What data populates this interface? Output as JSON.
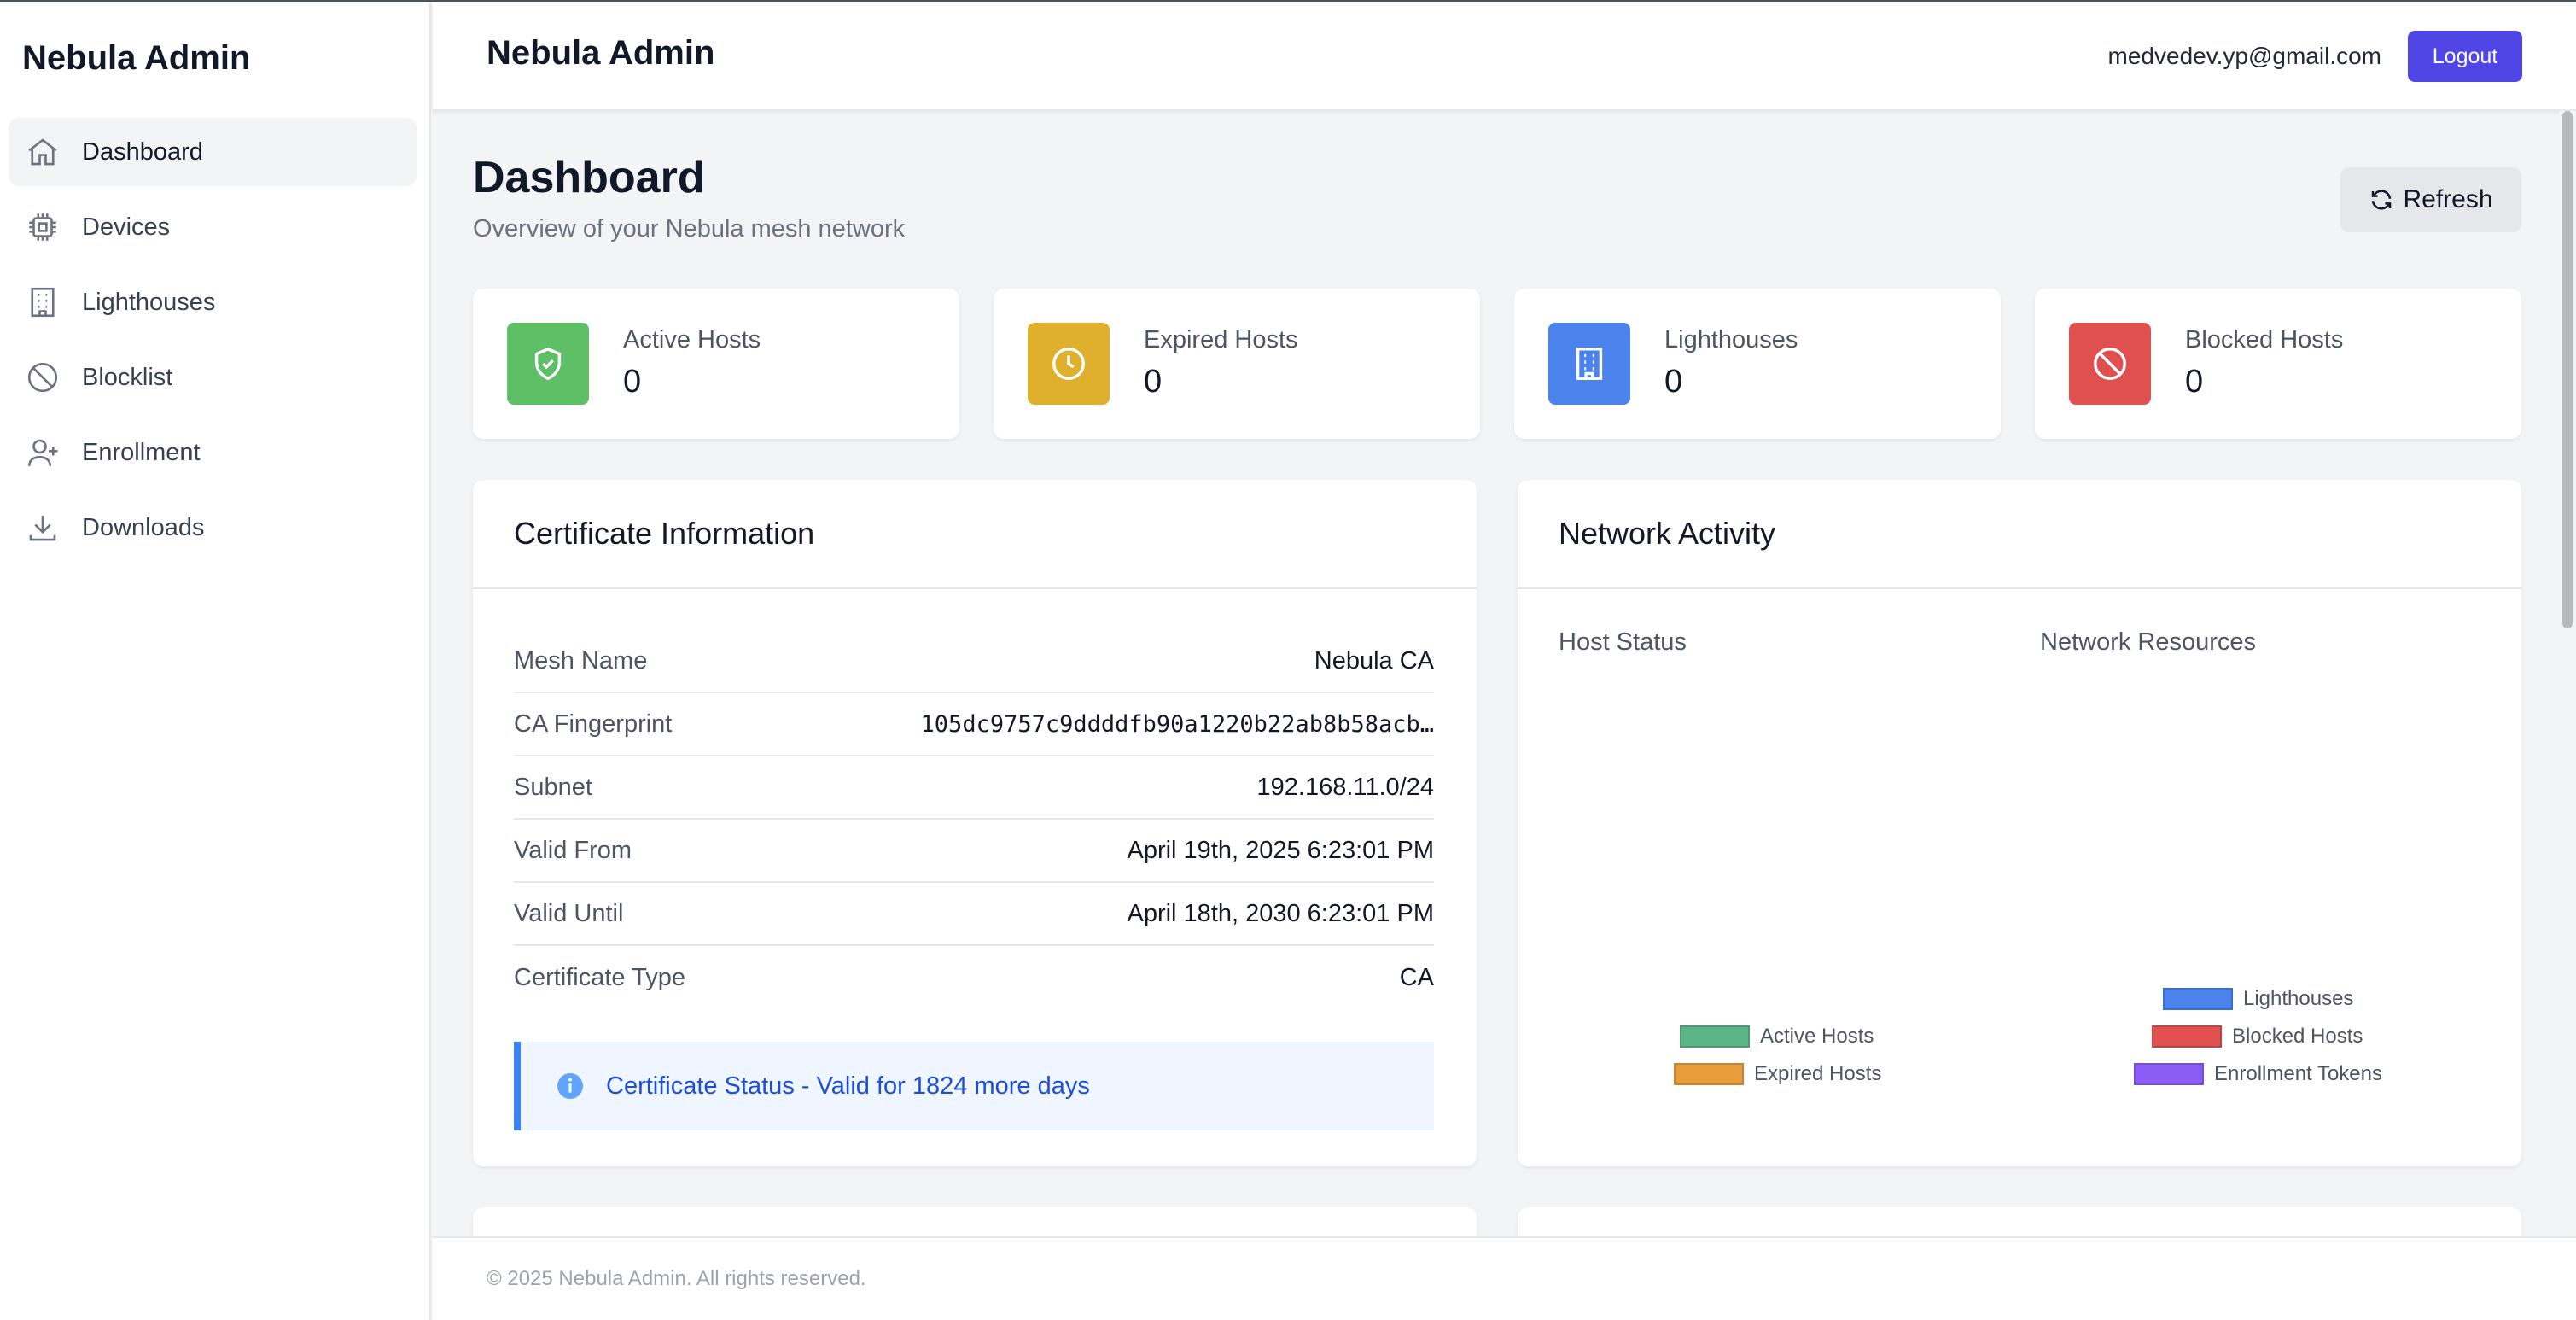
{
  "sidebar": {
    "brand": "Nebula Admin",
    "items": [
      {
        "label": "Dashboard",
        "icon": "home-icon",
        "active": true
      },
      {
        "label": "Devices",
        "icon": "chip-icon",
        "active": false
      },
      {
        "label": "Lighthouses",
        "icon": "building-icon",
        "active": false
      },
      {
        "label": "Blocklist",
        "icon": "ban-icon",
        "active": false
      },
      {
        "label": "Enrollment",
        "icon": "user-plus-icon",
        "active": false
      },
      {
        "label": "Downloads",
        "icon": "download-icon",
        "active": false
      }
    ]
  },
  "header": {
    "title": "Nebula Admin",
    "email": "medvedev.yp@gmail.com",
    "logout_label": "Logout"
  },
  "page": {
    "title": "Dashboard",
    "subtitle": "Overview of your Nebula mesh network",
    "refresh_label": "Refresh"
  },
  "stats": [
    {
      "label": "Active Hosts",
      "value": "0",
      "icon": "shield-check-icon",
      "color": "#5ebf66"
    },
    {
      "label": "Expired Hosts",
      "value": "0",
      "icon": "clock-icon",
      "color": "#dfb02e"
    },
    {
      "label": "Lighthouses",
      "value": "0",
      "icon": "building-icon",
      "color": "#4b82ec"
    },
    {
      "label": "Blocked Hosts",
      "value": "0",
      "icon": "ban-icon",
      "color": "#e0504e"
    }
  ],
  "certificate": {
    "title": "Certificate Information",
    "rows": [
      {
        "key": "Mesh Name",
        "value": "Nebula CA"
      },
      {
        "key": "CA Fingerprint",
        "value": "105dc9757c9ddddfb90a1220b22ab8b58acb…"
      },
      {
        "key": "Subnet",
        "value": "192.168.11.0/24"
      },
      {
        "key": "Valid From",
        "value": "April 19th, 2025 6:23:01 PM"
      },
      {
        "key": "Valid Until",
        "value": "April 18th, 2030 6:23:01 PM"
      },
      {
        "key": "Certificate Type",
        "value": "CA"
      }
    ],
    "status": "Certificate Status - Valid for 1824 more days"
  },
  "network": {
    "title": "Network Activity",
    "host_status_label": "Host Status",
    "resources_label": "Network Resources"
  },
  "chart_data": [
    {
      "type": "pie",
      "title": "Host Status",
      "categories": [
        "Active Hosts",
        "Expired Hosts"
      ],
      "values": [
        0,
        0
      ],
      "colors": [
        "#5ab686",
        "#e89c3c"
      ],
      "legend": "bottom"
    },
    {
      "type": "pie",
      "title": "Network Resources",
      "categories": [
        "Lighthouses",
        "Blocked Hosts",
        "Enrollment Tokens"
      ],
      "values": [
        0,
        0,
        0
      ],
      "colors": [
        "#4b82ec",
        "#e0504e",
        "#8b5cf6"
      ],
      "legend": "bottom"
    }
  ],
  "footer": {
    "text": "© 2025 Nebula Admin. All rights reserved."
  }
}
